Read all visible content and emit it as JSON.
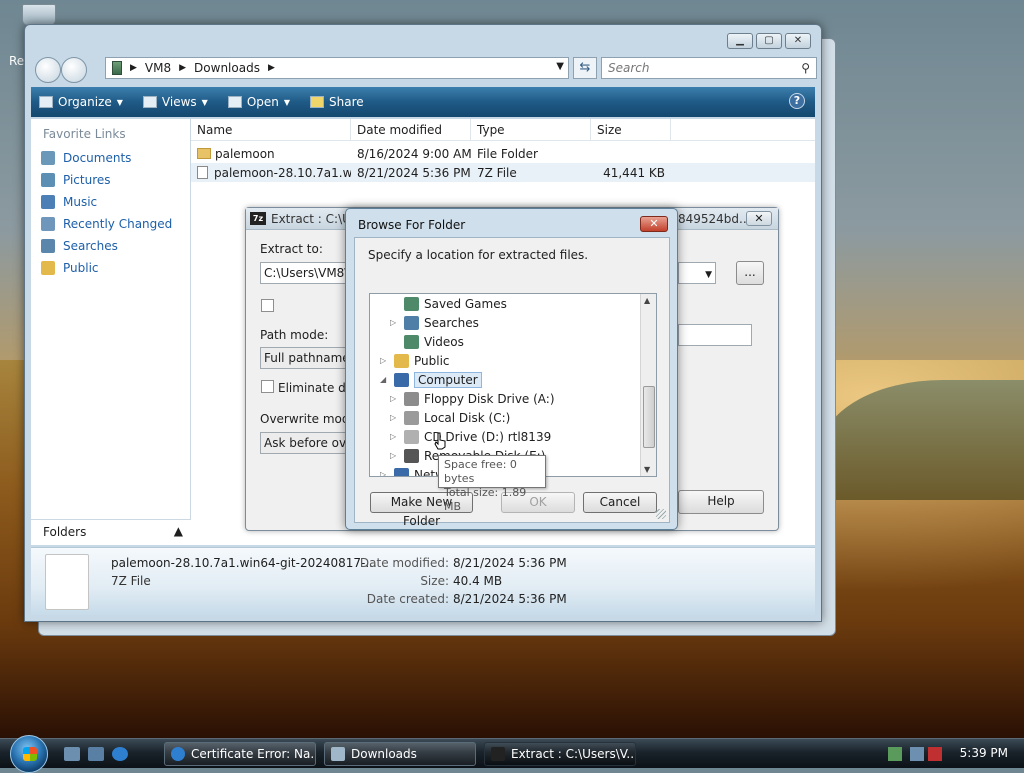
{
  "desktop": {
    "label": "Re"
  },
  "explorer": {
    "address": [
      "VM8",
      "Downloads"
    ],
    "search_placeholder": "Search",
    "toolbar": {
      "organize": "Organize",
      "views": "Views",
      "open": "Open",
      "share": "Share",
      "help": "?"
    },
    "favorites_title": "Favorite Links",
    "favorites": [
      "Documents",
      "Pictures",
      "Music",
      "Recently Changed",
      "Searches",
      "Public"
    ],
    "folders_label": "Folders",
    "columns": {
      "name": "Name",
      "date": "Date modified",
      "type": "Type",
      "size": "Size"
    },
    "files": [
      {
        "name": "palemoon",
        "date": "8/16/2024 9:00 AM",
        "type": "File Folder",
        "size": ""
      },
      {
        "name": "palemoon-28.10.7a1.w...",
        "date": "8/21/2024 5:36 PM",
        "type": "7Z File",
        "size": "41,441 KB"
      }
    ],
    "details": {
      "name": "palemoon-28.10.7a1.win64-git-20240817-...",
      "type": "7Z File",
      "modified_label": "Date modified:",
      "modified": "8/21/2024 5:36 PM",
      "size_label": "Size:",
      "size": "40.4 MB",
      "created_label": "Date created:",
      "created": "8/21/2024 5:36 PM"
    }
  },
  "extract": {
    "title": "Extract : C:\\Use",
    "title_tail": "849524bd...",
    "close": "✕",
    "extract_to_label": "Extract to:",
    "extract_to_value": "C:\\Users\\VM8\\D",
    "browse_btn": "...",
    "path_mode_label": "Path mode:",
    "path_mode_value": "Full pathnames",
    "eliminate_label": "Eliminate duplic",
    "overwrite_label": "Overwrite mode:",
    "overwrite_value": "Ask before overw",
    "help_btn": "Help"
  },
  "browse": {
    "title": "Browse For Folder",
    "close": "✕",
    "description": "Specify a location for extracted files.",
    "tree": [
      {
        "label": "Saved Games",
        "level": 2,
        "arrow": "",
        "icon": "#4e8a6a"
      },
      {
        "label": "Searches",
        "level": 2,
        "arrow": "▷",
        "icon": "#4f7ea6"
      },
      {
        "label": "Videos",
        "level": 2,
        "arrow": "",
        "icon": "#4e8a6a"
      },
      {
        "label": "Public",
        "level": 1,
        "arrow": "▷",
        "icon": "#e3b94c"
      },
      {
        "label": "Computer",
        "level": 1,
        "arrow": "◢",
        "icon": "#3a6aa8",
        "selected": true
      },
      {
        "label": "Floppy Disk Drive (A:)",
        "level": 2,
        "arrow": "▷",
        "icon": "#8c8c8c"
      },
      {
        "label": "Local Disk (C:)",
        "level": 2,
        "arrow": "▷",
        "icon": "#9a9a9a"
      },
      {
        "label": "CD Drive (D:) rtl8139",
        "level": 2,
        "arrow": "▷",
        "icon": "#b0b0b0"
      },
      {
        "label": "Removable Disk (E:)",
        "level": 2,
        "arrow": "▷",
        "icon": "#555555"
      },
      {
        "label": "Network",
        "level": 1,
        "arrow": "▷",
        "icon": "#3a6aa8"
      }
    ],
    "tooltip": [
      "Space free: 0 bytes",
      "Total size: 1.89 MB"
    ],
    "make_folder": "Make New Folder",
    "ok": "OK",
    "cancel": "Cancel"
  },
  "taskbar": {
    "tasks": [
      "Certificate Error: Na...",
      "Downloads",
      "Extract : C:\\Users\\V..."
    ],
    "clock": "5:39 PM"
  }
}
